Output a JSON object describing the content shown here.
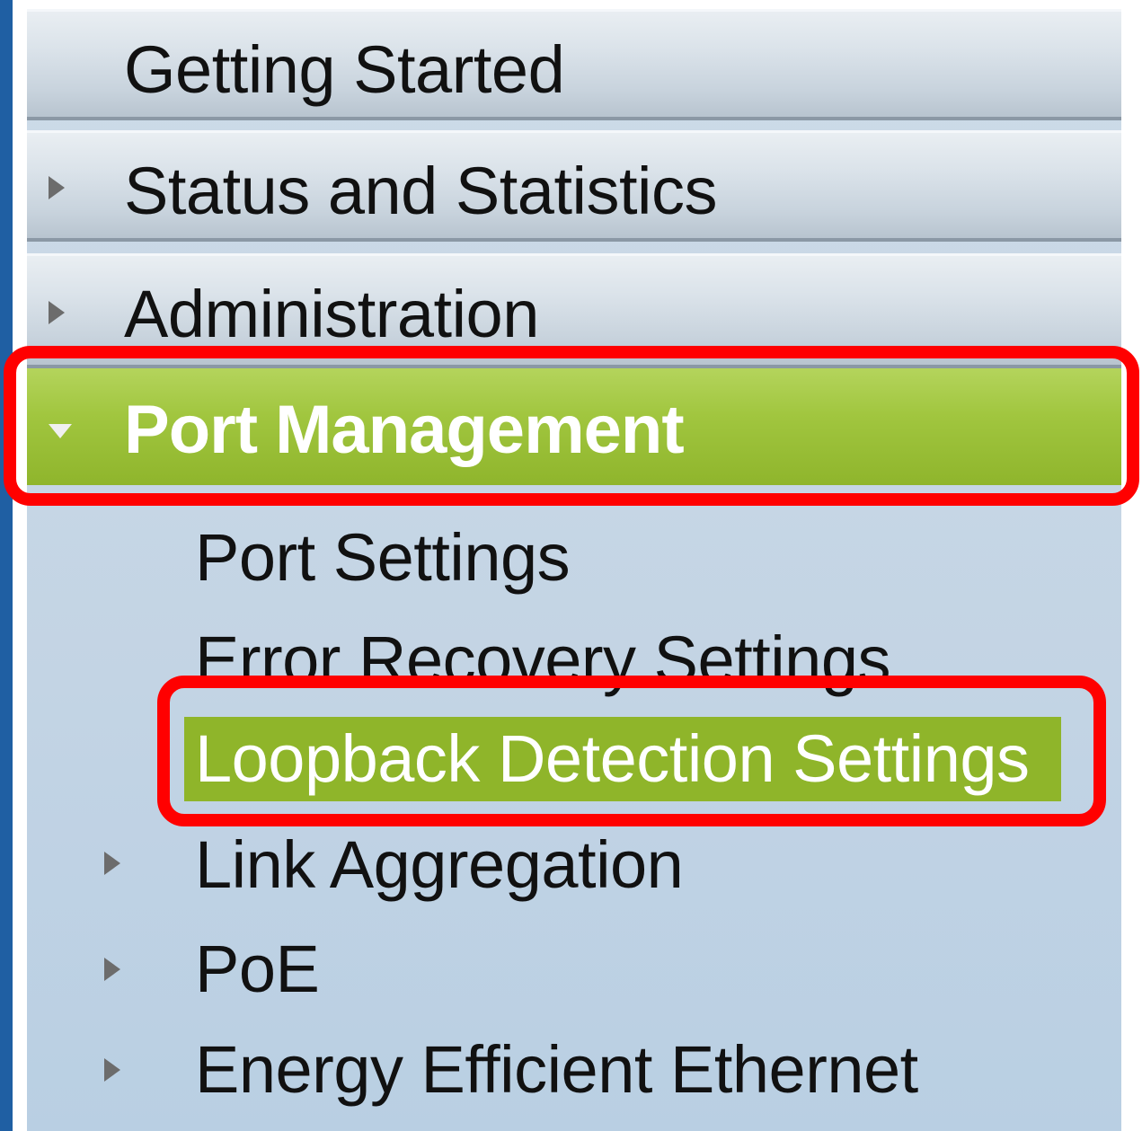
{
  "nav": {
    "getting_started": "Getting Started",
    "status_and_statistics": "Status and Statistics",
    "administration": "Administration",
    "port_management": "Port Management",
    "port_management_items": {
      "port_settings": "Port Settings",
      "error_recovery_settings": "Error Recovery Settings",
      "loopback_detection_settings": "Loopback Detection Settings",
      "link_aggregation": "Link Aggregation",
      "poe": "PoE",
      "energy_efficient_ethernet": "Energy Efficient Ethernet"
    }
  },
  "icons": {
    "collapsed": "triangle-right-icon",
    "expanded": "triangle-down-icon"
  },
  "colors": {
    "selected_green": "#9cc03a",
    "highlight_red": "#ff0000",
    "sidebar_blue": "#c3d4e4"
  }
}
